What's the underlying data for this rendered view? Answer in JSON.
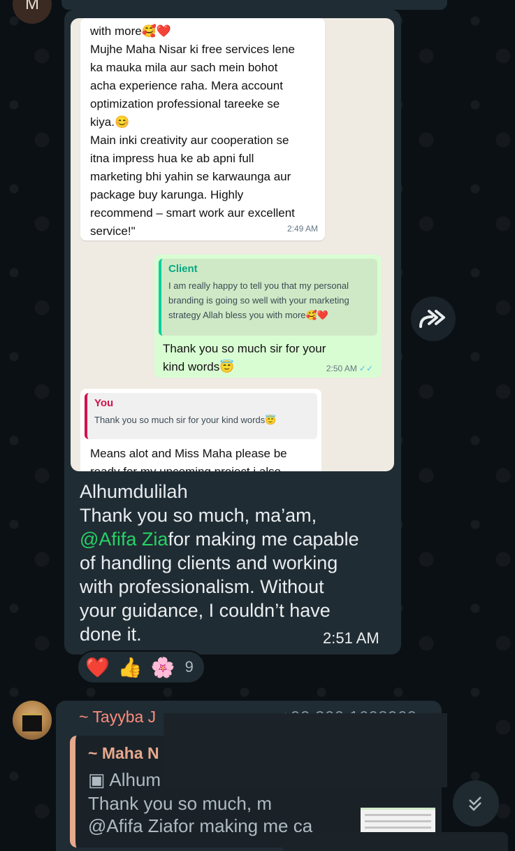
{
  "top_avatar": {
    "initial": "M"
  },
  "screenshot": {
    "incoming_message": {
      "lines": [
        "with more🥰❤️",
        "Mujhe Maha Nisar ki free services lene",
        "ka mauka mila aur sach mein bohot",
        "acha experience raha. Mera account",
        "optimization professional tareeke se",
        "kiya.😊",
        "Main inki creativity aur cooperation se",
        "itna impress hua ke ab apni full",
        "marketing bhi yahin se karwaunga aur",
        "package buy karunga. Highly",
        "recommend – smart work aur excellent",
        "service!\""
      ],
      "time": "2:49 AM"
    },
    "outgoing_message": {
      "quote_name": "Client",
      "quote_text": "I am really happy to tell you that my personal branding is going so well with your marketing strategy Allah bless you with more🥰❤️",
      "text": "Thank you so much sir for your kind words😇",
      "time": "2:50 AM"
    },
    "incoming_reply": {
      "quote_name": "You",
      "quote_text": "Thank you so much sir for your kind words😇",
      "text_lines": [
        "Means alot and Miss Maha please be",
        "ready for my upcoming project i also"
      ]
    }
  },
  "main_message": {
    "line1": "Alhumdulilah",
    "line2": "Thank you so much, ma’am,",
    "mention": "@Afifa Zia",
    "line3_rest": "for making me capable",
    "line4": "of handling clients and working",
    "line5": "with professionalism. Without",
    "line6": "your guidance, I couldn’t have",
    "line7": "done it.",
    "time": "2:51 AM"
  },
  "reactions": {
    "emoji1": "❤️",
    "emoji2": "👍",
    "emoji3": "🌸",
    "count": "9"
  },
  "second_message": {
    "sender": "~ Tayyba J",
    "phone": "+92 300 1608960",
    "quoted_sender": "~ Maha N",
    "quoted_line1": "Alhum",
    "quoted_line2": "Thank you so much, m",
    "quoted_line3": "@Afifa Ziafor making me ca"
  },
  "icons": {
    "forward": "forward-icon",
    "scroll": "double-check-down-icon",
    "image": "image-icon"
  },
  "colors": {
    "background": "#0b1014",
    "bubble": "#202c33",
    "mention": "#25d366",
    "outgoing": "#d9fdd3",
    "sender": "#fc8c7d"
  }
}
